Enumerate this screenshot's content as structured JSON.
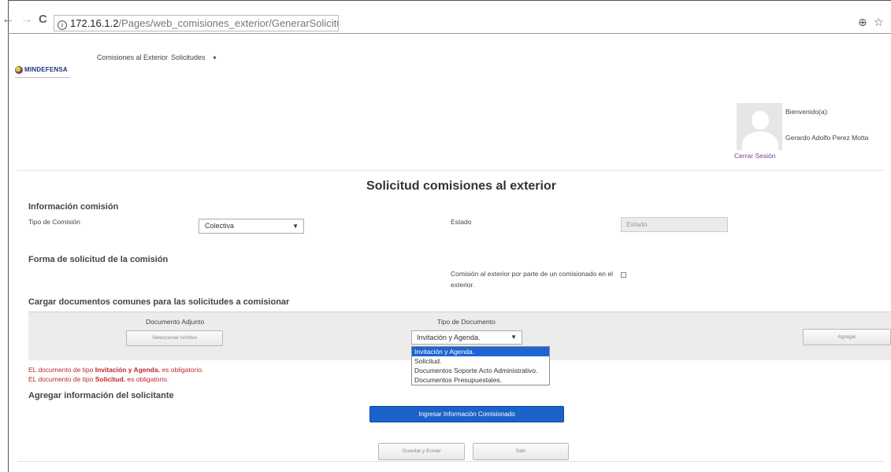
{
  "browser": {
    "back": "←",
    "forward": "→",
    "reload": "C",
    "url_host": "172.16.1.2",
    "url_path": "/Pages/web_comisiones_exterior/GenerarSolicitud.aspx",
    "zoom_icon": "⊕",
    "star_icon": "☆"
  },
  "header": {
    "logo_text": "MINDEFENSA",
    "nav": [
      {
        "label": "Comisiones al Exterior"
      },
      {
        "label": "Solicitudes"
      }
    ]
  },
  "user": {
    "welcome": "Bienvenido(a):",
    "name": "Gerardo Adolfo Perez Motta",
    "logout": "Cerrar Sesión"
  },
  "form": {
    "title": "Solicitud comisiones al exterior",
    "info_section": "Información comisión",
    "tipo_label": "Tipo de Comisión",
    "tipo_value": "Colectiva",
    "estado_label": "Estado",
    "estado_placeholder": "Estado",
    "forma_section": "Forma de solicitud de la comisión",
    "exterior_label_line1": "Comisión al exterior por parte de un comisionado en el",
    "exterior_label_line2": "exterior.",
    "docs_section": "Cargar documentos comunes para las solicitudes a comisionar",
    "doc_adjunto_label": "Documento Adjunto",
    "select_file_button": "Seleccionar Archivo",
    "tipo_doc_label": "Tipo de Documento",
    "tipo_doc_value": "Invitación y Agenda.",
    "tipo_doc_options": [
      "Invitación y Agenda.",
      "Solicitud.",
      "Documentos Soporte Acto Administrativo.",
      "Documentos Presupuestales."
    ],
    "add_button": "Agregar",
    "errors": [
      {
        "prefix": "EL documento de tipo ",
        "doc": "Invitación y Agenda.",
        "suffix": " es obligatorio."
      },
      {
        "prefix": "EL documento de tipo ",
        "doc": "Solicitud.",
        "suffix": " es obligatorio."
      }
    ],
    "solicitante_section": "Agregar información del solicitante",
    "ingresar_button": "Ingresar Información Comisionado",
    "guardar_button": "Guardar y Enviar",
    "salir_button": "Salir"
  },
  "colors": {
    "primary": "#1b63c9",
    "error": "#c0262d",
    "dropdown_highlight": "#1e64d2",
    "logout_link": "#7a3a9a"
  }
}
